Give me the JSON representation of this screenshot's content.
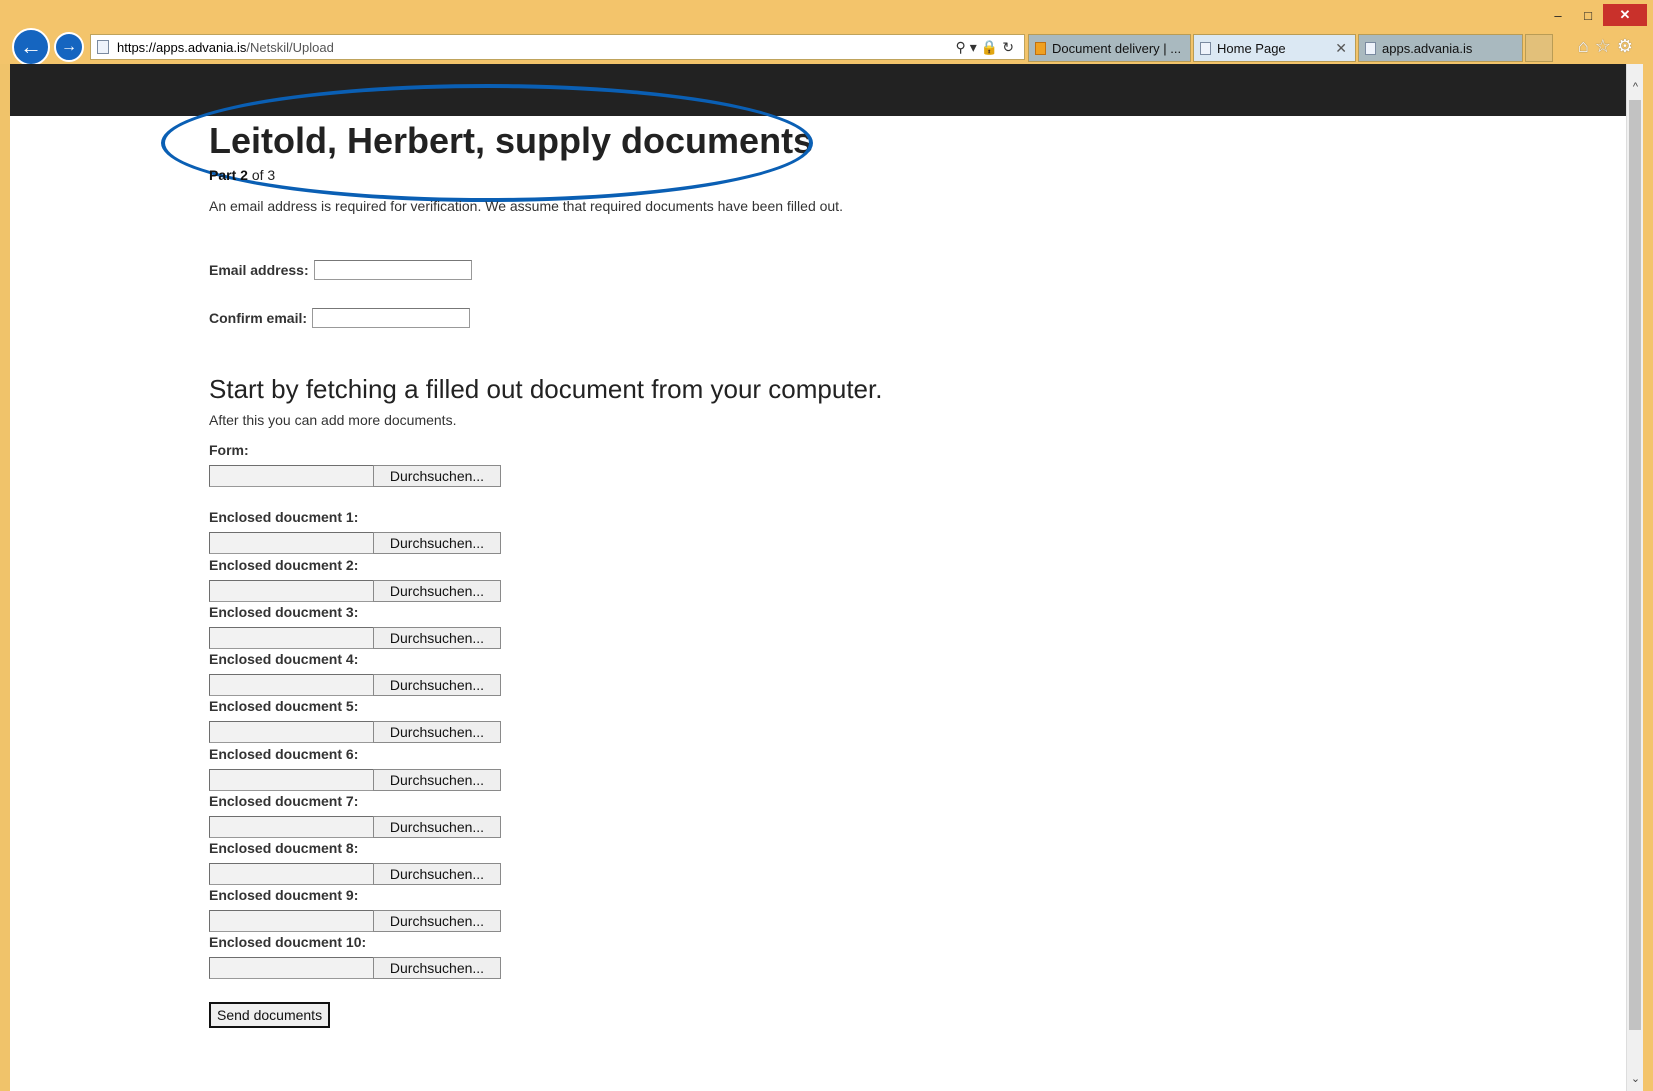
{
  "browser": {
    "url_scheme": "https://",
    "url_host": "apps.advania.is",
    "url_path": "/Netskil/Upload",
    "tabs": [
      {
        "label": "Document delivery | ..."
      },
      {
        "label": "Home Page"
      },
      {
        "label": "apps.advania.is"
      }
    ],
    "window_controls": {
      "minimize": "–",
      "maximize": "□",
      "close": "✕"
    }
  },
  "page": {
    "title": "Leitold, Herbert, supply documents",
    "part_label": "Part",
    "part_current": "2",
    "part_of": "of 3",
    "intro": "An email address is required for verification. We assume that required documents have been filled out.",
    "email_label": "Email address:",
    "confirm_label": "Confirm email:",
    "email_value": "",
    "confirm_value": "",
    "fetch_heading": "Start by fetching a filled out document from your computer.",
    "fetch_sub": "After this you can add more documents.",
    "form_label": "Form:",
    "browse_label": "Durchsuchen...",
    "enclosed": [
      "Enclosed doucment 1:",
      "Enclosed doucment 2:",
      "Enclosed doucment 3:",
      "Enclosed doucment 4:",
      "Enclosed doucment 5:",
      "Enclosed doucment 6:",
      "Enclosed doucment 7:",
      "Enclosed doucment 8:",
      "Enclosed doucment 9:",
      "Enclosed doucment 10:"
    ],
    "send_label": "Send documents"
  },
  "colors": {
    "chrome": "#f3c46b",
    "header_bar": "#222222",
    "annotation_oval": "#0a5fb4",
    "close_button": "#c9312b"
  }
}
